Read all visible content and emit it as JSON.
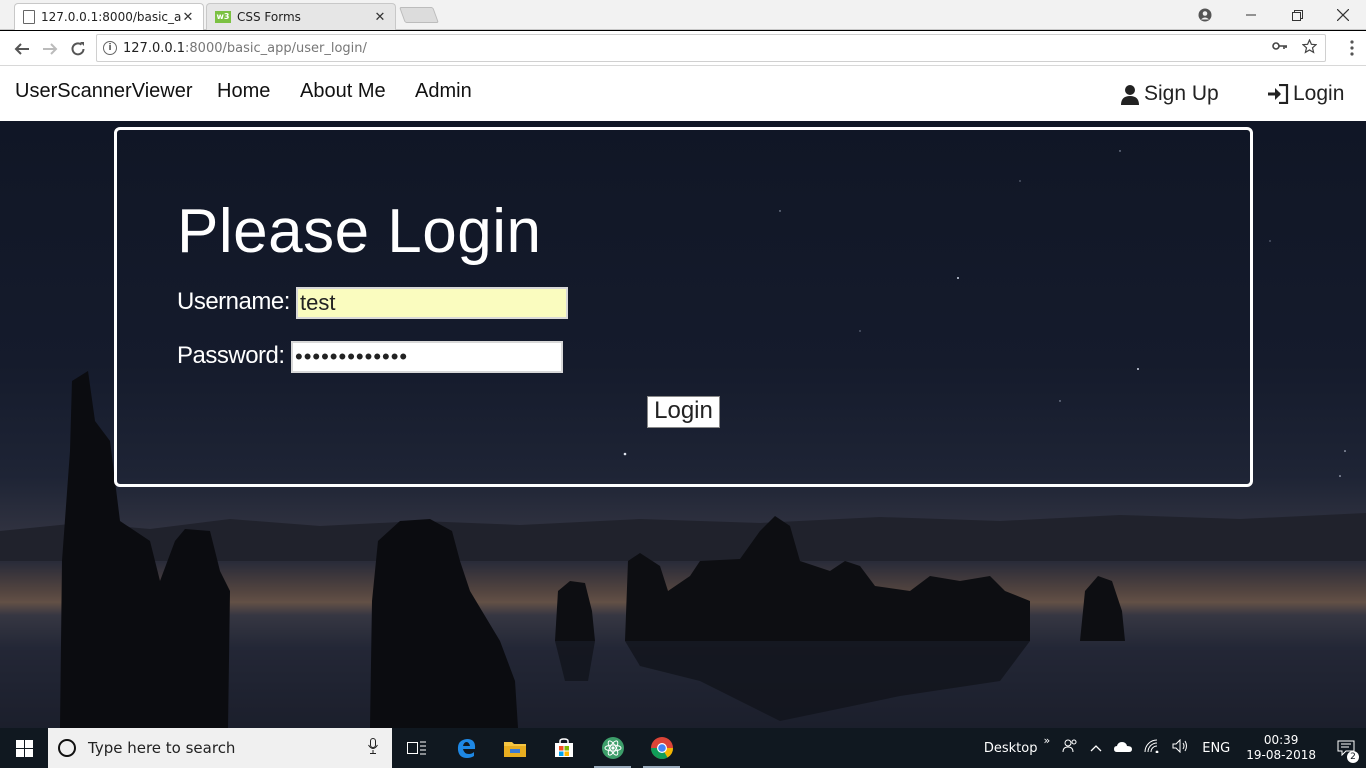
{
  "browser": {
    "tabs": [
      {
        "title": "127.0.0.1:8000/basic_app",
        "active": true
      },
      {
        "title": "CSS Forms",
        "active": false
      }
    ],
    "w3_badge": "w3",
    "address": {
      "host": "127.0.0.1",
      "path": ":8000/basic_app/user_login/"
    },
    "info_glyph": "i"
  },
  "navbar": {
    "brand": "UserScannerViewer",
    "links": [
      "Home",
      "About Me",
      "Admin"
    ],
    "signup": "Sign Up",
    "login": "Login"
  },
  "login_form": {
    "title": "Please Login",
    "username_label": "Username:",
    "username_value": "test",
    "password_label": "Password:",
    "password_value": "•••••••••••••",
    "submit_label": "Login"
  },
  "taskbar": {
    "search_placeholder": "Type here to search",
    "desktop_label": "Desktop",
    "language": "ENG",
    "time": "00:39",
    "date": "19-08-2018",
    "notification_count": "2"
  },
  "colors": {
    "username_input_bg": "#fafcbf",
    "navbar_bg": "#ffffff",
    "taskbar_bg": "#101820"
  }
}
